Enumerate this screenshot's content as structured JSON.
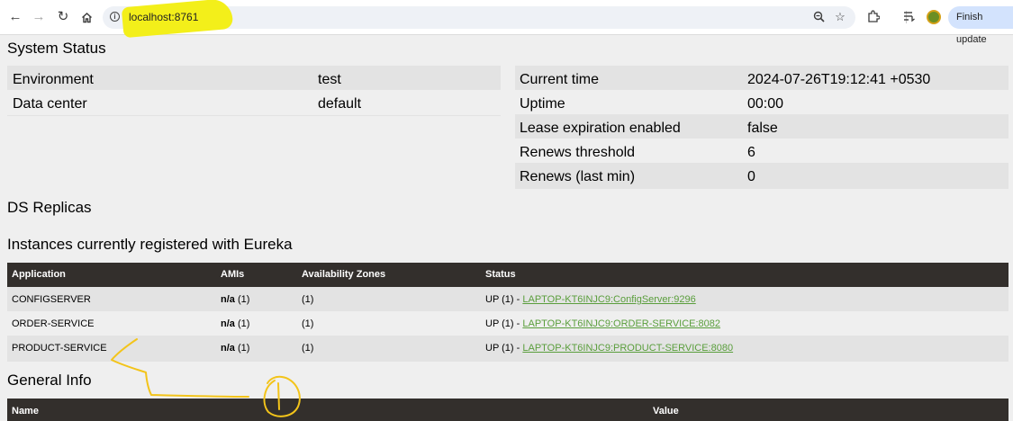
{
  "browser": {
    "url": "localhost:8761",
    "update_button_label": "Finish update",
    "icons": [
      "back-icon",
      "forward-icon",
      "reload-icon",
      "home-icon",
      "site-info-icon",
      "zoom-icon",
      "bookmark-star-icon",
      "extensions-icon",
      "reading-list-icon",
      "profile-avatar",
      "more-menu-icon"
    ]
  },
  "system_status": {
    "title": "System Status",
    "left": [
      {
        "label": "Environment",
        "value": "test"
      },
      {
        "label": "Data center",
        "value": "default"
      }
    ],
    "right": [
      {
        "label": "Current time",
        "value": "2024-07-26T19:12:41 +0530"
      },
      {
        "label": "Uptime",
        "value": "00:00"
      },
      {
        "label": "Lease expiration enabled",
        "value": "false"
      },
      {
        "label": "Renews threshold",
        "value": "6"
      },
      {
        "label": "Renews (last min)",
        "value": "0"
      }
    ]
  },
  "ds_replicas": {
    "title": "DS Replicas"
  },
  "instances": {
    "title": "Instances currently registered with Eureka",
    "columns": [
      "Application",
      "AMIs",
      "Availability Zones",
      "Status"
    ],
    "rows": [
      {
        "application": "CONFIGSERVER",
        "amis": "n/a",
        "amis_count": "(1)",
        "zones": "(1)",
        "status": "UP (1) - ",
        "link": "LAPTOP-KT6INJC9:ConfigServer:9296"
      },
      {
        "application": "ORDER-SERVICE",
        "amis": "n/a",
        "amis_count": "(1)",
        "zones": "(1)",
        "status": "UP (1) - ",
        "link": "LAPTOP-KT6INJC9:ORDER-SERVICE:8082"
      },
      {
        "application": "PRODUCT-SERVICE",
        "amis": "n/a",
        "amis_count": "(1)",
        "zones": "(1)",
        "status": "UP (1) - ",
        "link": "LAPTOP-KT6INJC9:PRODUCT-SERVICE:8080"
      }
    ]
  },
  "general_info": {
    "title": "General Info",
    "columns": [
      "Name",
      "Value"
    ]
  },
  "colors": {
    "table_header": "#332f2c",
    "link": "#5a9e3c",
    "annotation": "#f3c41a",
    "url_highlight": "#f3ef1a"
  }
}
